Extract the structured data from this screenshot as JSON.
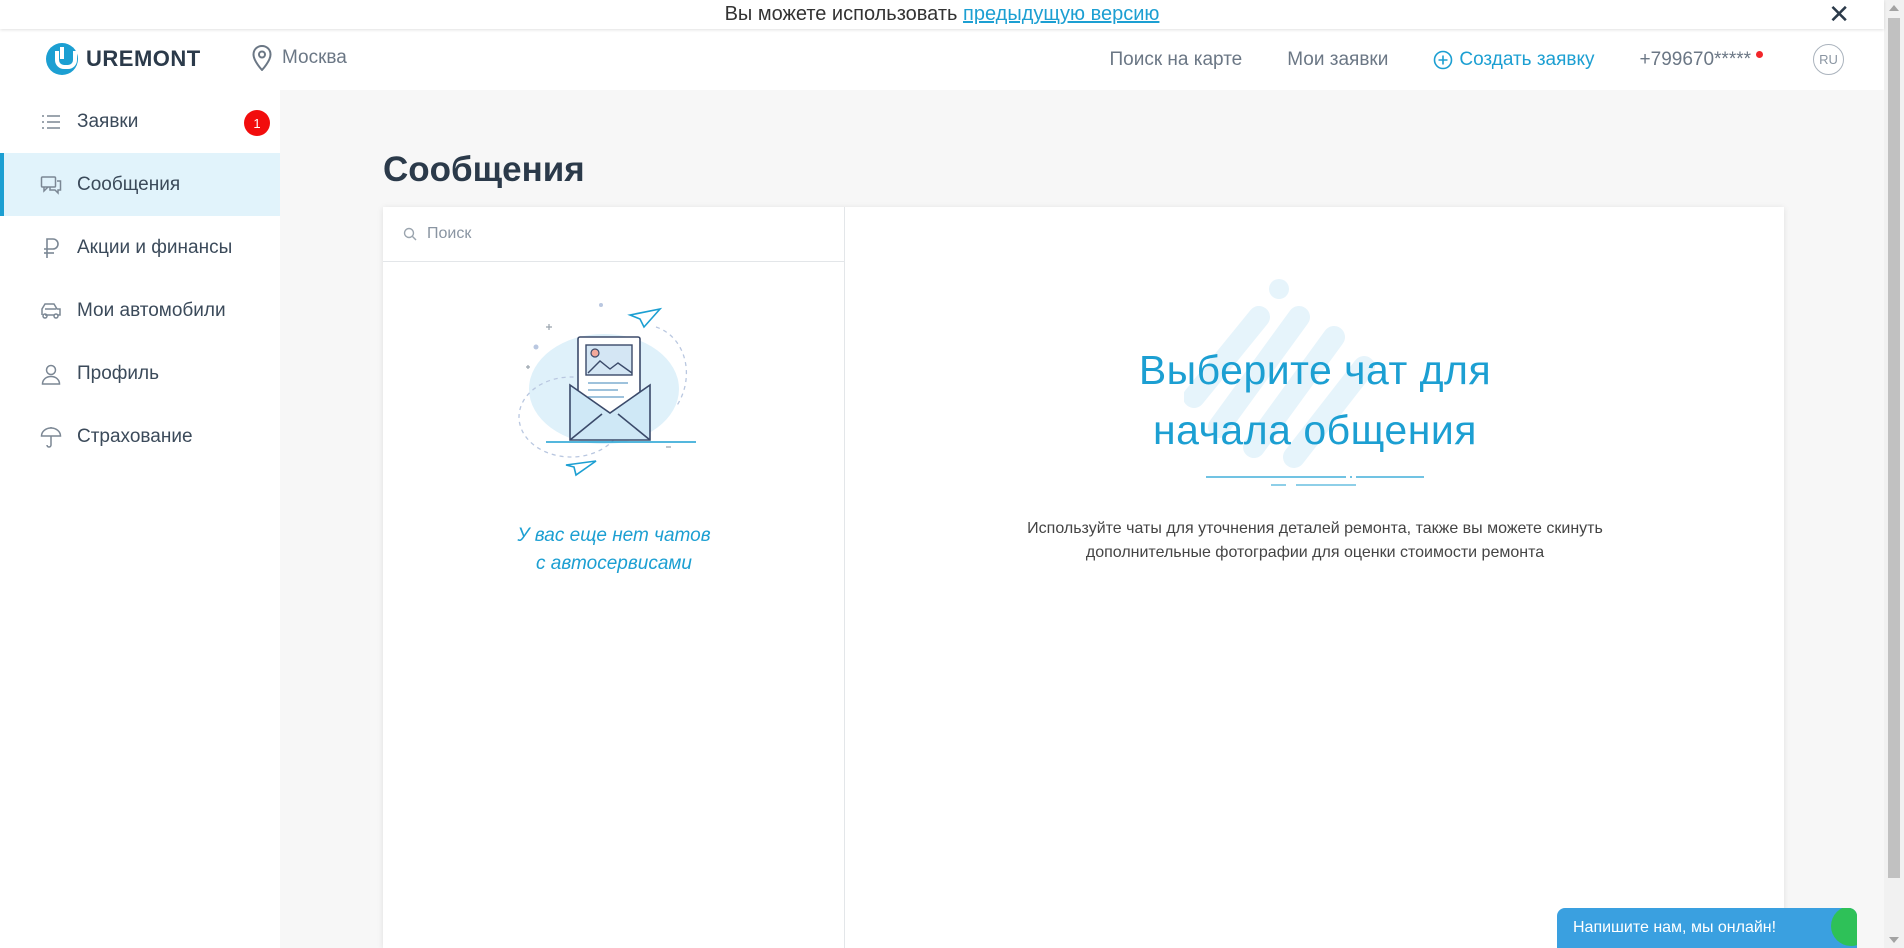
{
  "banner": {
    "text": "Вы можете использовать",
    "link": "предыдущую версию",
    "close": "✕"
  },
  "header": {
    "logo": "UREMONT",
    "city": "Москва",
    "nav": {
      "map_search": "Поиск на карте",
      "my_requests": "Мои заявки",
      "create_request": "Создать заявку",
      "phone": "+799670*****",
      "lang": "RU"
    }
  },
  "sidebar": {
    "items": [
      {
        "label": "Заявки",
        "icon": "list-icon",
        "badge": "1"
      },
      {
        "label": "Сообщения",
        "icon": "chat-icon",
        "active": true
      },
      {
        "label": "Акции и финансы",
        "icon": "ruble-icon"
      },
      {
        "label": "Мои автомобили",
        "icon": "car-icon"
      },
      {
        "label": "Профиль",
        "icon": "user-icon"
      },
      {
        "label": "Страхование",
        "icon": "umbrella-icon"
      }
    ]
  },
  "main": {
    "title": "Сообщения",
    "search": {
      "placeholder": "Поиск"
    },
    "empty_line1": "У вас еще нет чатов",
    "empty_line2": "с автосервисами",
    "chat_title_line1": "Выберите чат для",
    "chat_title_line2": "начала общения",
    "chat_description": "Используйте чаты для уточнения деталей ремонта, также вы можете скинуть дополнительные фотографии для оценки стоимости ремонта"
  },
  "widget": {
    "label": "Напишите нам, мы онлайн!"
  },
  "colors": {
    "accent": "#1c9fd2",
    "badge": "#f20d0d",
    "active_bg": "#e1f3fb",
    "online": "#2ec158"
  }
}
